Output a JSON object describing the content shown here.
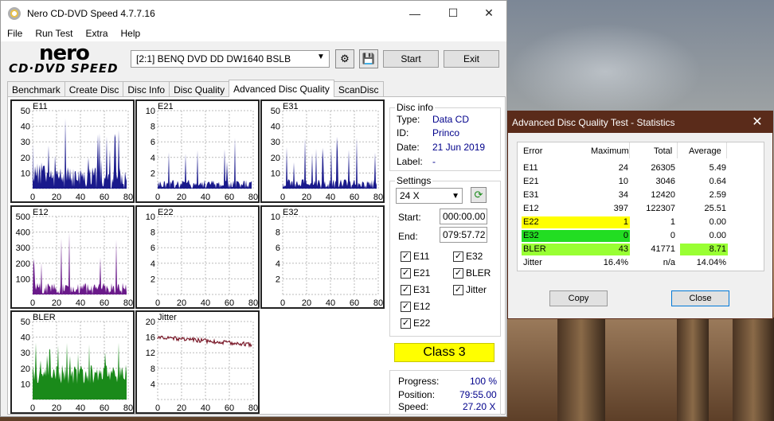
{
  "window": {
    "title": "Nero CD-DVD Speed 4.7.7.16",
    "min": "—",
    "max": "☐",
    "close": "✕"
  },
  "menu": [
    "File",
    "Run Test",
    "Extra",
    "Help"
  ],
  "logo": {
    "line1": "nero",
    "line2": "CD·DVD SPEED"
  },
  "toolbar": {
    "drive": "[2:1]   BENQ DVD DD DW1640 BSLB",
    "start_label": "Start",
    "exit_label": "Exit"
  },
  "tabs": [
    "Benchmark",
    "Create Disc",
    "Disc Info",
    "Disc Quality",
    "Advanced Disc Quality",
    "ScanDisc"
  ],
  "active_tab": "Advanced Disc Quality",
  "graphs": [
    {
      "name": "E11",
      "yticks": [
        "50",
        "40",
        "30",
        "20",
        "10"
      ],
      "xticks": [
        "0",
        "20",
        "40",
        "60",
        "80"
      ],
      "color": "#1a1a8c"
    },
    {
      "name": "E21",
      "yticks": [
        "10",
        "8",
        "6",
        "4",
        "2"
      ],
      "xticks": [
        "0",
        "20",
        "40",
        "60",
        "80"
      ],
      "color": "#1a1a8c"
    },
    {
      "name": "E31",
      "yticks": [
        "50",
        "40",
        "30",
        "20",
        "10"
      ],
      "xticks": [
        "0",
        "20",
        "40",
        "60",
        "80"
      ],
      "color": "#1a1a8c"
    },
    {
      "name": "E12",
      "yticks": [
        "500",
        "400",
        "300",
        "200",
        "100"
      ],
      "xticks": [
        "0",
        "20",
        "40",
        "60",
        "80"
      ],
      "color": "#6a1a8a"
    },
    {
      "name": "E22",
      "yticks": [
        "10",
        "8",
        "6",
        "4",
        "2"
      ],
      "xticks": [
        "0",
        "20",
        "40",
        "60",
        "80"
      ],
      "color": "#6a1a8a"
    },
    {
      "name": "E32",
      "yticks": [
        "10",
        "8",
        "6",
        "4",
        "2"
      ],
      "xticks": [
        "0",
        "20",
        "40",
        "60",
        "80"
      ],
      "color": "#6a1a8a"
    },
    {
      "name": "BLER",
      "yticks": [
        "50",
        "40",
        "30",
        "20",
        "10"
      ],
      "xticks": [
        "0",
        "20",
        "40",
        "60",
        "80"
      ],
      "color": "#1a8a1a"
    },
    {
      "name": "Jitter",
      "yticks": [
        "20",
        "16",
        "12",
        "8",
        "4"
      ],
      "xticks": [
        "0",
        "20",
        "40",
        "60",
        "80"
      ],
      "color": "#7a1a2a"
    }
  ],
  "disc_info": {
    "title": "Disc info",
    "type_label": "Type:",
    "type": "Data CD",
    "id_label": "ID:",
    "id": "Princo",
    "date_label": "Date:",
    "date": "21 Jun 2019",
    "label_label": "Label:",
    "label": "-"
  },
  "settings": {
    "title": "Settings",
    "speed": "24 X",
    "start_label": "Start:",
    "start": "000:00.00",
    "end_label": "End:",
    "end": "079:57.72",
    "checks": [
      {
        "label": "E11",
        "checked": true
      },
      {
        "label": "E32",
        "checked": true
      },
      {
        "label": "E21",
        "checked": true
      },
      {
        "label": "BLER",
        "checked": true
      },
      {
        "label": "E31",
        "checked": true
      },
      {
        "label": "Jitter",
        "checked": true
      },
      {
        "label": "E12",
        "checked": true
      },
      {
        "label": "E22",
        "checked": true
      }
    ]
  },
  "class_label": "Class 3",
  "progress": {
    "progress_label": "Progress:",
    "progress": "100 %",
    "position_label": "Position:",
    "position": "79:55.00",
    "speed_label": "Speed:",
    "speed": "27.20 X"
  },
  "stats": {
    "title": "Advanced Disc Quality Test - Statistics",
    "close": "✕",
    "headers": [
      "Error",
      "Maximum",
      "Total",
      "Average"
    ],
    "rows": [
      {
        "name": "E11",
        "max": "24",
        "total": "26305",
        "avg": "5.49"
      },
      {
        "name": "E21",
        "max": "10",
        "total": "3046",
        "avg": "0.64"
      },
      {
        "name": "E31",
        "max": "34",
        "total": "12420",
        "avg": "2.59"
      },
      {
        "name": "E12",
        "max": "397",
        "total": "122307",
        "avg": "25.51"
      },
      {
        "name": "E22",
        "max": "1",
        "total": "1",
        "avg": "0.00"
      },
      {
        "name": "E32",
        "max": "0",
        "total": "0",
        "avg": "0.00"
      },
      {
        "name": "BLER",
        "max": "43",
        "total": "41771",
        "avg": "8.71"
      },
      {
        "name": "Jitter",
        "max": "16.4%",
        "total": "n/a",
        "avg": "14.04%"
      }
    ],
    "highlight_colors": {
      "yellow": "#ffff00",
      "green": "#22dd22",
      "lime": "#99ff33"
    },
    "copy_label": "Copy",
    "close_label": "Close"
  }
}
